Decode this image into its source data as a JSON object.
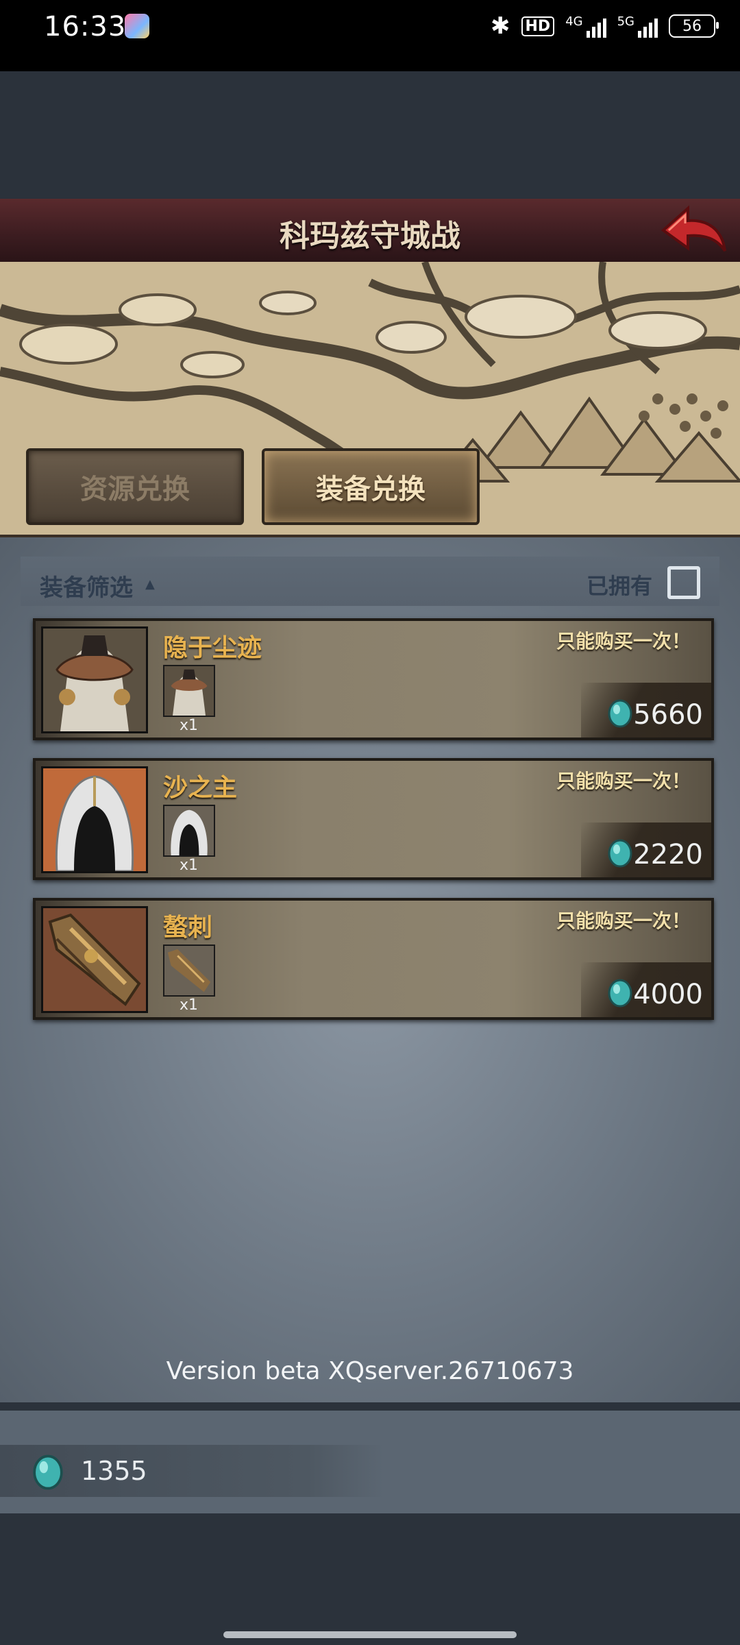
{
  "status_bar": {
    "time": "16:33",
    "hd_label": "HD",
    "network_4g": "4G",
    "network_5g": "5G",
    "battery": "56"
  },
  "header": {
    "title": "科玛兹守城战"
  },
  "tabs": [
    {
      "label": "资源兑换",
      "active": false
    },
    {
      "label": "装备兑换",
      "active": true
    }
  ],
  "filter": {
    "label": "装备筛选",
    "owned_label": "已拥有",
    "owned_checked": false
  },
  "items": [
    {
      "name": "隐于尘迹",
      "limit": "只能购买一次！",
      "qty": "x1",
      "price": "5660"
    },
    {
      "name": "沙之主",
      "limit": "只能购买一次！",
      "qty": "x1",
      "price": "2220"
    },
    {
      "name": "螯刺",
      "limit": "只能购买一次！",
      "qty": "x1",
      "price": "4000"
    }
  ],
  "version": "Version beta XQserver.26710673",
  "currency": {
    "value": "1355"
  },
  "colors": {
    "item_name": "#e8b350",
    "limit_text": "#f1dfaa",
    "gem": "#3fb3b0",
    "title_bar": "#4a2226"
  }
}
